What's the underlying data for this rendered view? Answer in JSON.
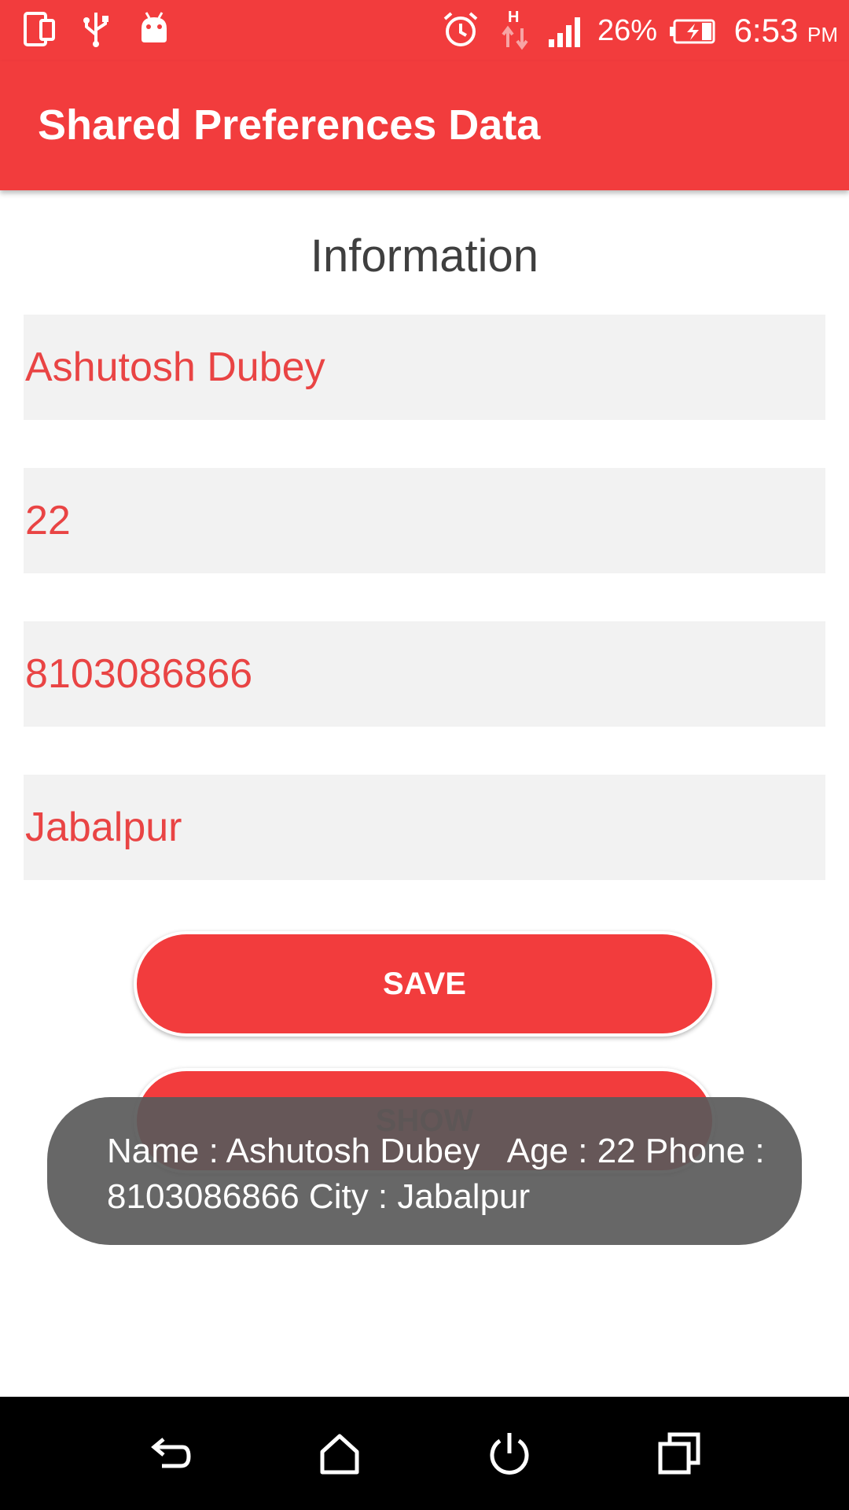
{
  "status_bar": {
    "battery_percent": "26%",
    "time": "6:53",
    "ampm": "PM",
    "network_type": "H",
    "icons": [
      "screen-icon",
      "usb-icon",
      "android-icon",
      "alarm-icon",
      "data-arrows-icon",
      "signal-icon",
      "battery-charging-icon"
    ]
  },
  "app_bar": {
    "title": "Shared Preferences Data"
  },
  "form": {
    "heading": "Information",
    "fields": [
      {
        "value": "Ashutosh Dubey"
      },
      {
        "value": "22"
      },
      {
        "value": "8103086866"
      },
      {
        "value": "Jabalpur"
      }
    ],
    "save_label": "SAVE",
    "show_label": "SHOW"
  },
  "toast": {
    "line1": "Name : Ashutosh Dubey   Age : 22 Phone :",
    "line2": "8103086866 City : Jabalpur"
  },
  "nav_bar": {
    "icons": [
      "back-icon",
      "home-icon",
      "power-icon",
      "recents-icon"
    ]
  },
  "colors": {
    "primary": "#F23C3D",
    "field_text": "#E94444",
    "field_bg": "#F2F2F2"
  }
}
